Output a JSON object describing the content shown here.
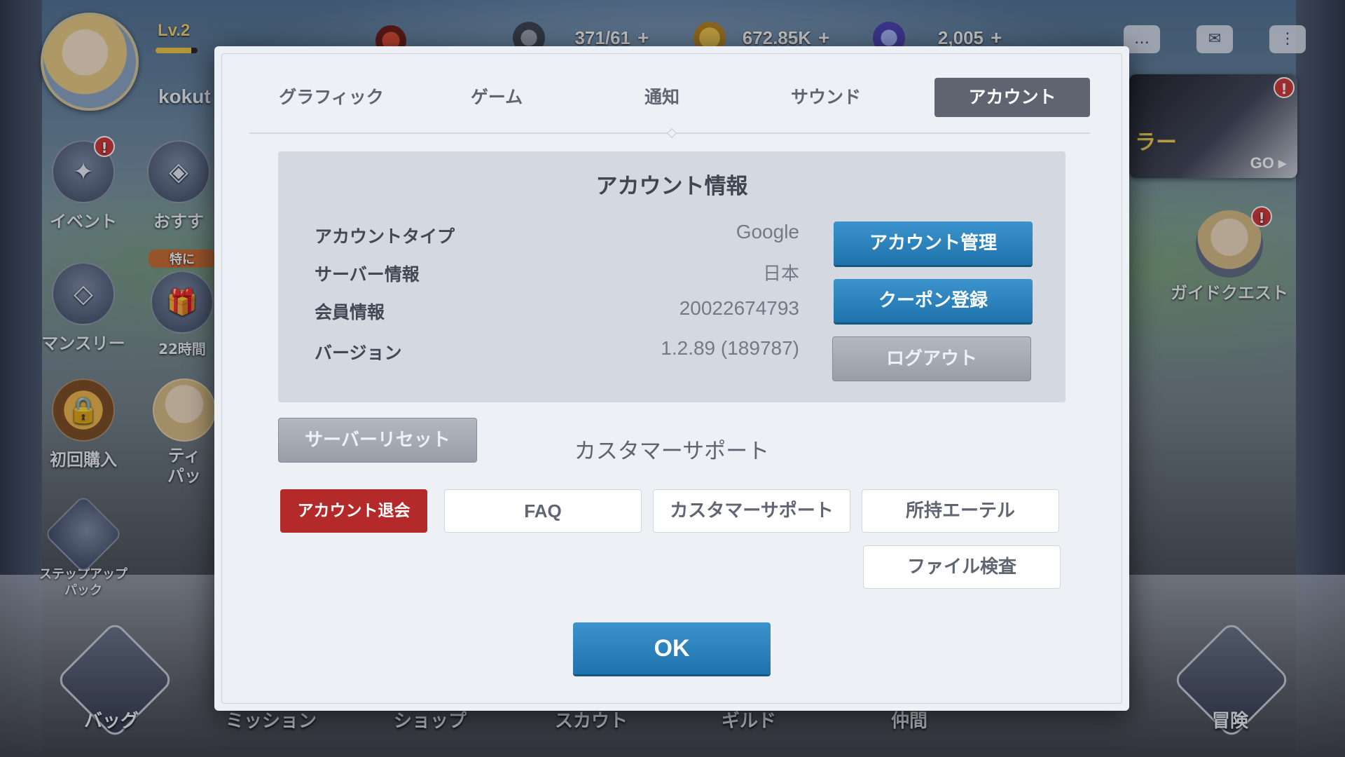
{
  "hud": {
    "level": "Lv.2",
    "level_progress": 0.85,
    "player_name": "kokut",
    "resource_1": "371/61",
    "resource_2": "672.85K",
    "resource_3": "2,005",
    "plus": "+"
  },
  "side_left": {
    "event": "イベント",
    "recommend": "おすす",
    "special_tag": "特に",
    "monthly": "マンスリー",
    "timer": "22時間",
    "first_purchase": "初回購入",
    "tia_pack_1": "ティ",
    "tia_pack_2": "パッ",
    "stepup_1": "ステップアップ",
    "stepup_2": "パック",
    "alert": "!"
  },
  "side_right": {
    "banner_text": "ラー",
    "banner_go": "GO ▸",
    "guide_quest": "ガイドクエスト"
  },
  "bottom_nav": {
    "bag": "バッグ",
    "mission": "ミッション",
    "shop": "ショップ",
    "scout": "スカウト",
    "guild": "ギルド",
    "friends": "仲間",
    "adventure": "冒険"
  },
  "modal": {
    "tabs": [
      {
        "label": "グラフィック"
      },
      {
        "label": "ゲーム"
      },
      {
        "label": "通知"
      },
      {
        "label": "サウンド"
      },
      {
        "label": "アカウント"
      }
    ],
    "active_tab": "アカウント",
    "account_info": {
      "title": "アカウント情報",
      "rows": [
        {
          "label": "アカウントタイプ",
          "value": "Google"
        },
        {
          "label": "サーバー情報",
          "value": "日本"
        },
        {
          "label": "会員情報",
          "value": "20022674793"
        },
        {
          "label": "バージョン",
          "value": "1.2.89 (189787)"
        }
      ],
      "manage_button": "アカウント管理",
      "coupon_button": "クーポン登録",
      "logout_button": "ログアウト"
    },
    "server_reset_button": "サーバーリセット",
    "support_title": "カスタマーサポート",
    "support_buttons": {
      "withdraw": "アカウント退会",
      "faq": "FAQ",
      "support": "カスタマーサポート",
      "ether": "所持エーテル",
      "file_check": "ファイル検査"
    },
    "ok_button": "OK"
  },
  "colors": {
    "accent_blue": "#2a84bf",
    "danger_red": "#b42929",
    "active_tab": "#5e6470"
  }
}
